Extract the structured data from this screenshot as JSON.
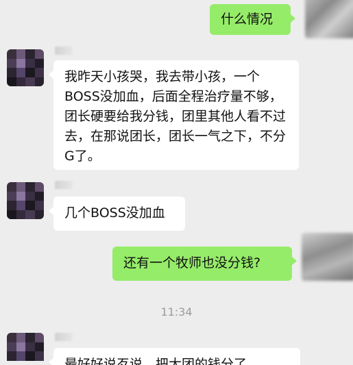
{
  "colors": {
    "background": "#ededed",
    "incoming_bubble": "#ffffff",
    "outgoing_bubble": "#95ec69",
    "timestamp_text": "#9b9b9b"
  },
  "messages": [
    {
      "direction": "outgoing",
      "text": "什么情况"
    },
    {
      "direction": "incoming",
      "text": "我昨天小孩哭，我去带小孩，一个BOSS没加血，后面全程治疗量不够，团长硬要给我分钱，团里其他人看不过去，在那说团长，团长一气之下，不分G了。"
    },
    {
      "direction": "incoming",
      "text": "几个BOSS没加血"
    },
    {
      "direction": "outgoing",
      "text": "还有一个牧师也没分钱?"
    }
  ],
  "timestamp": "11:34",
  "partial_message": {
    "direction": "incoming",
    "text": "最好好说歹说，把大团的钱分了"
  }
}
